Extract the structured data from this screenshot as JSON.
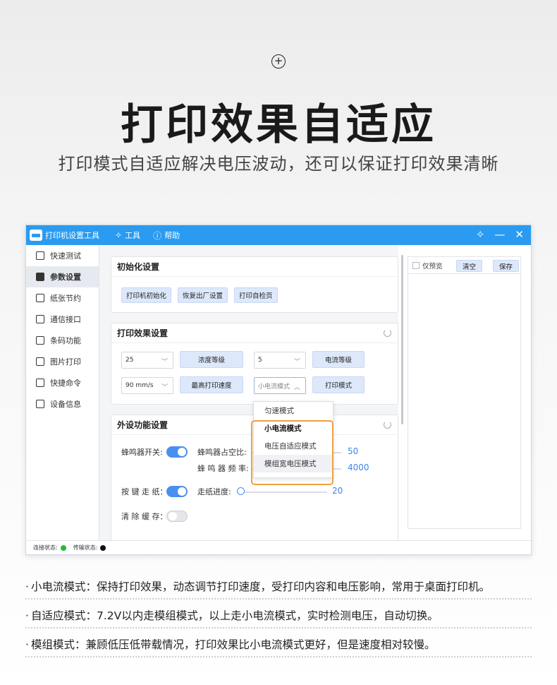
{
  "hero": {
    "title": "打印效果自适应",
    "subtitle": "打印模式自适应解决电压波动，还可以保证打印效果清晰",
    "icon": "plus-circle-icon"
  },
  "app": {
    "title": "打印机设置工具",
    "menu": [
      {
        "label": "工具",
        "icon": "tools-icon"
      },
      {
        "label": "帮助",
        "icon": "help-icon"
      }
    ],
    "window_controls": {
      "pin": "✧",
      "minimize": "—",
      "close": "✕"
    }
  },
  "sidebar": {
    "items": [
      {
        "label": "快速测试",
        "active": false
      },
      {
        "label": "参数设置",
        "active": true
      },
      {
        "label": "纸张节约",
        "active": false
      },
      {
        "label": "通信接口",
        "active": false
      },
      {
        "label": "条码功能",
        "active": false
      },
      {
        "label": "图片打印",
        "active": false
      },
      {
        "label": "快捷命令",
        "active": false
      },
      {
        "label": "设备信息",
        "active": false
      }
    ]
  },
  "init_card": {
    "title": "初始化设置",
    "buttons": [
      "打印机初始化",
      "恢复出厂设置",
      "打印自检页"
    ]
  },
  "effect_card": {
    "title": "打印效果设置",
    "density_value": "25",
    "density_button": "浓度等级",
    "current_value": "5",
    "current_button": "电流等级",
    "speed_value": "90 mm/s",
    "speed_button": "最高打印速度",
    "mode_value": "小电流模式",
    "mode_button": "打印模式"
  },
  "mode_dropdown": {
    "options": [
      "匀速模式",
      "小电流模式",
      "电压自适应模式",
      "模组宽电压模式"
    ]
  },
  "peripheral_card": {
    "title": "外设功能设置",
    "buzzer_label": "蜂鸣器开关:",
    "buzzer_on": true,
    "duty_label": "蜂鸣器占空比:",
    "duty_value": "50",
    "freq_label": "蜂 鸣 器 频 率:",
    "freq_value": "4000",
    "feed_key_label": "按 键 走 纸：",
    "feed_key_on": true,
    "feed_progress_label": "走纸进度:",
    "feed_progress_value": "20",
    "clear_cache_label": "清 除 缓 存：",
    "clear_cache_on": false
  },
  "right_panel": {
    "preview_label": "仅预览",
    "clear_button": "清空",
    "save_button": "保存"
  },
  "status_bar": {
    "connection_label": "连接状态:",
    "connection_color": "#22bb33",
    "transfer_label": "传输状态:",
    "transfer_color": "#111111"
  },
  "notes": [
    "小电流模式：保持打印效果，动态调节打印速度，受打印内容和电压影响，常用于桌面打印机。",
    "自适应模式：7.2V以内走模组模式，以上走小电流模式，实时检测电压，自动切换。",
    "模组模式：兼顾低压低带载情况，打印效果比小电流模式更好，但是速度相对较慢。"
  ]
}
